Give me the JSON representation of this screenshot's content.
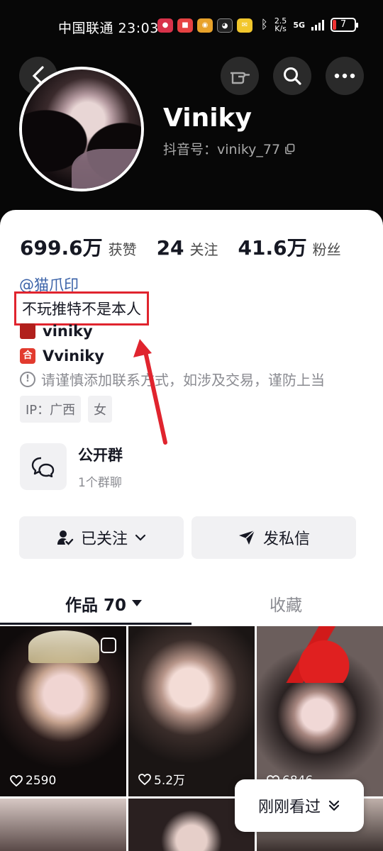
{
  "status_bar": {
    "carrier_time": "中国联通 23:03",
    "net_speed_value": "2.5",
    "net_speed_unit": "K/s",
    "signal": "5G",
    "battery": "7"
  },
  "profile": {
    "name": "Viniky",
    "douyin_id": "抖音号：viniky_77"
  },
  "stats": [
    {
      "value": "699.6万",
      "label": "获赞"
    },
    {
      "value": "24",
      "label": "关注"
    },
    {
      "value": "41.6万",
      "label": "粉丝"
    }
  ],
  "bio": {
    "mention": "@猫爪印",
    "signature": "不玩推特不是本人",
    "xiaohongshu": "viniky",
    "other_account": "Vviniky",
    "warning": "请谨慎添加联系方式，如涉及交易，谨防上当",
    "tags": [
      "IP：广西",
      "女"
    ]
  },
  "group": {
    "title": "公开群",
    "subtitle": "1个群聊"
  },
  "buttons": {
    "follow": "已关注",
    "message": "发私信"
  },
  "tabs": {
    "works": "作品 70",
    "favorites": "收藏"
  },
  "videos": [
    {
      "likes": "2590"
    },
    {
      "likes": "5.2万"
    },
    {
      "likes": "6846"
    }
  ],
  "recently_viewed": "刚刚看过",
  "colors": {
    "header_bg": "#070707",
    "highlight_red": "#e0242e",
    "mention_blue": "#3a62a8"
  }
}
